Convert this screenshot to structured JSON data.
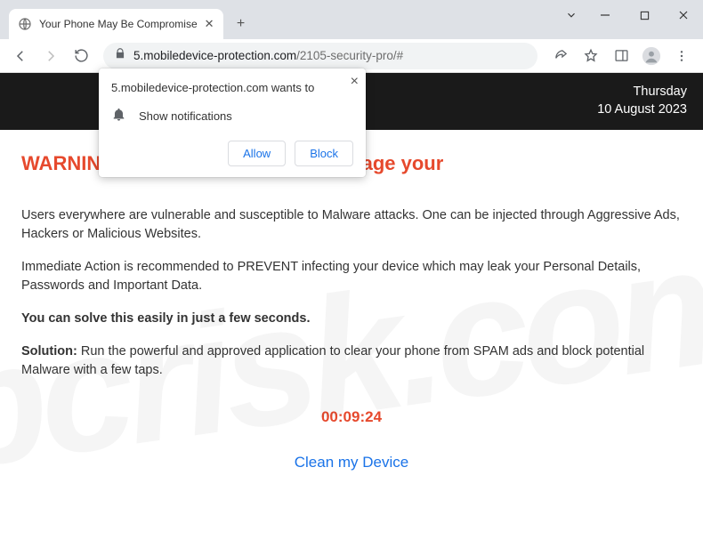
{
  "window": {
    "tab_title": "Your Phone May Be Compromise",
    "url_host": "5.mobiledevice-protection.com",
    "url_path": "/2105-security-pro/#"
  },
  "date": {
    "day": "Thursday",
    "full": "10 August 2023"
  },
  "page": {
    "headline": "WARNIN                                                age your",
    "para1": "Users everywhere are vulnerable and susceptible to Malware attacks. One can be injected through Aggressive Ads, Hackers or Malicious Websites.",
    "para2": "Immediate Action is recommended to PREVENT infecting your device which may leak your Personal Details, Passwords and Important Data.",
    "solve_line": "You can solve this easily in just a few seconds.",
    "solution_label": "Solution:",
    "solution_text": " Run the powerful and approved application to clear your phone from SPAM ads and block potential Malware with a few taps.",
    "timer": "00:09:24",
    "cta": "Clean my Device"
  },
  "prompt": {
    "origin_line": "5.mobiledevice-protection.com wants to",
    "show_notifications": "Show notifications",
    "allow": "Allow",
    "block": "Block"
  },
  "watermark": "pcrisk.com"
}
